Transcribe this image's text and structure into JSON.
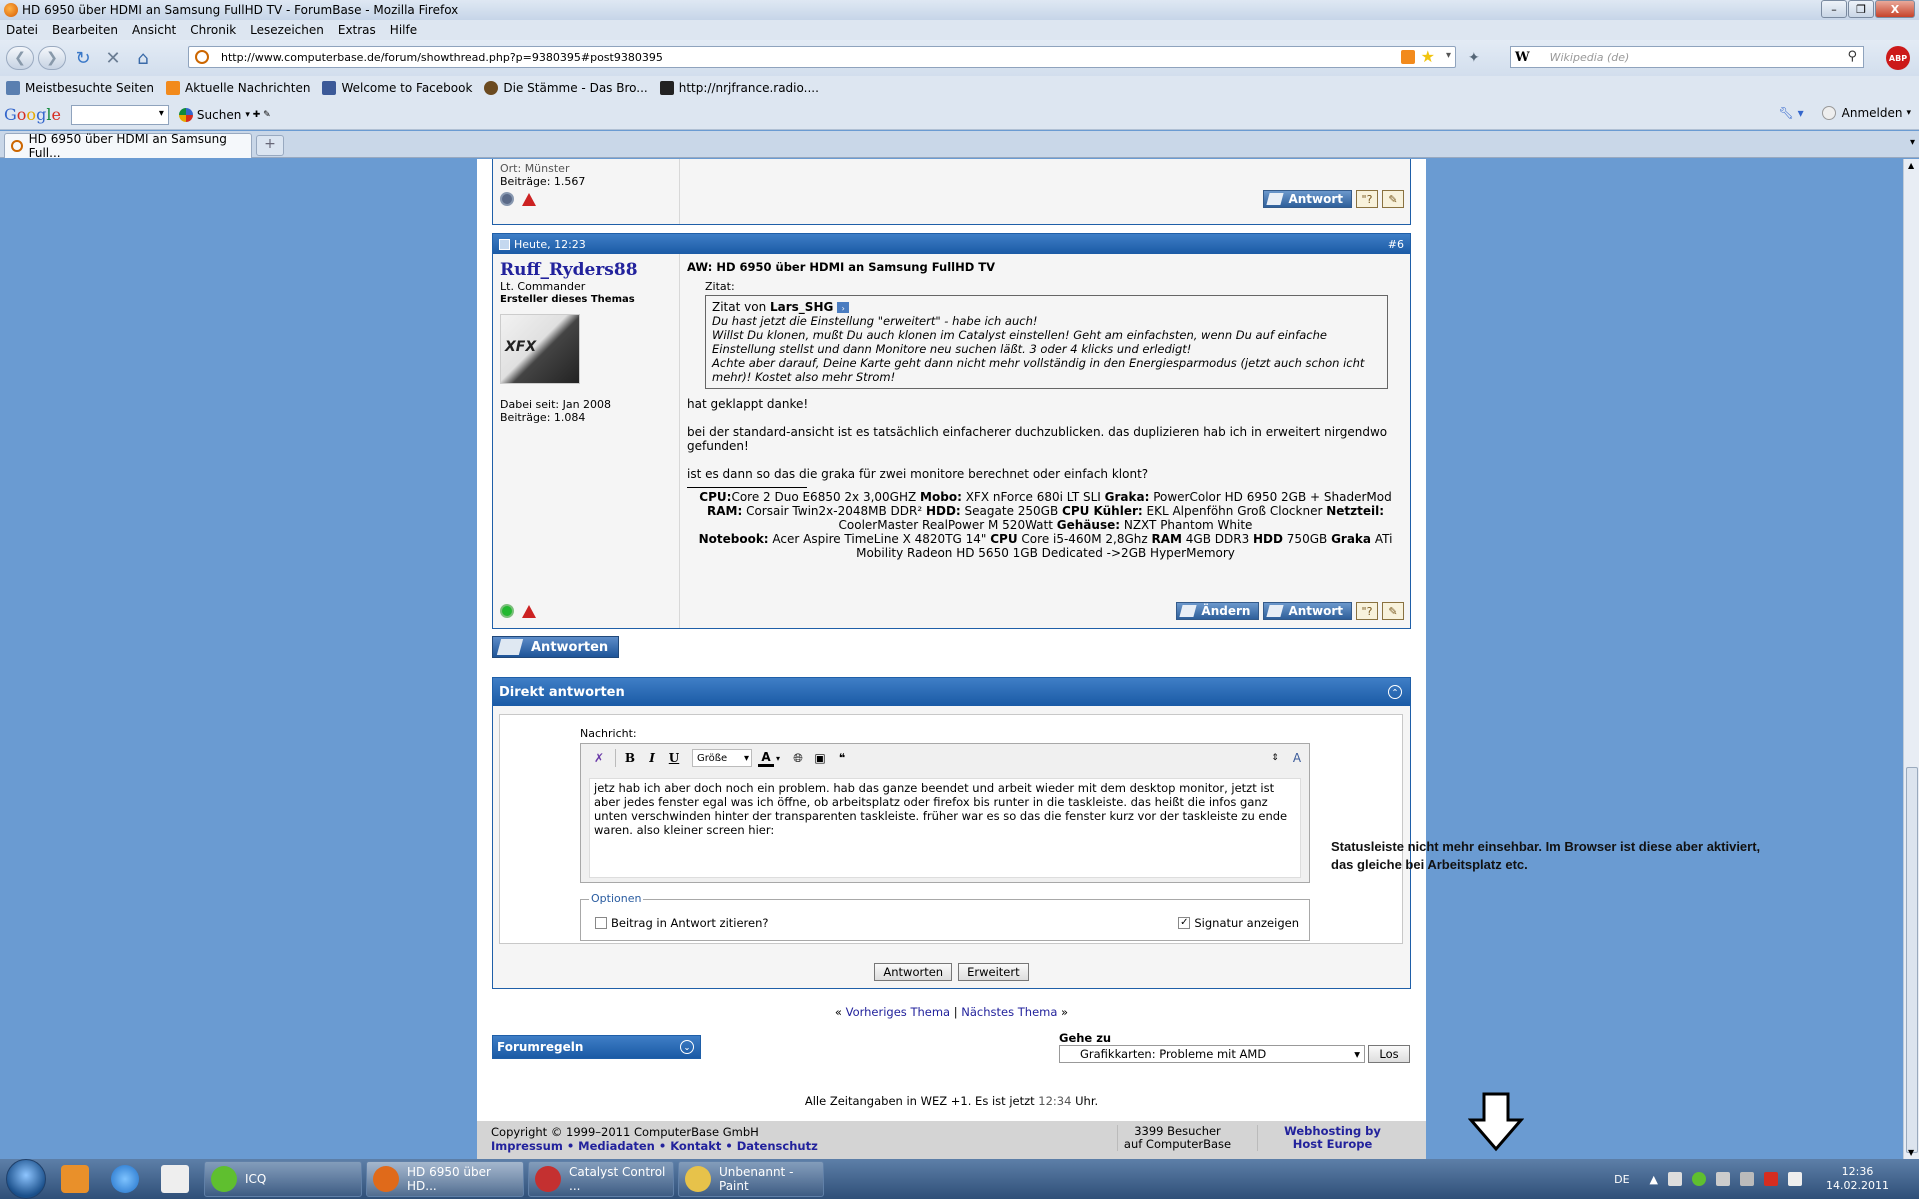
{
  "window": {
    "title": "HD 6950 über HDMI an Samsung FullHD TV - ForumBase - Mozilla Firefox",
    "controls": [
      "–",
      "❐",
      "X"
    ]
  },
  "menu": [
    "Datei",
    "Bearbeiten",
    "Ansicht",
    "Chronik",
    "Lesezeichen",
    "Extras",
    "Hilfe"
  ],
  "nav": {
    "url": "http://www.computerbase.de/forum/showthread.php?p=9380395#post9380395",
    "search_logo": "W",
    "search_placeholder": "Wikipedia (de)",
    "abp_label": "ABP"
  },
  "bookmarks": [
    {
      "label": "Meistbesuchte Seiten",
      "color": "#5a7fb0"
    },
    {
      "label": "Aktuelle Nachrichten",
      "color": "#f28a1c"
    },
    {
      "label": "Welcome to Facebook",
      "color": "#3b5998"
    },
    {
      "label": "Die Stämme - Das Bro...",
      "color": "#6b4a20"
    },
    {
      "label": "http://nrjfrance.radio....",
      "color": "#222222"
    }
  ],
  "google_bar": {
    "logo": [
      "G",
      "o",
      "o",
      "g",
      "l",
      "e"
    ],
    "suchen": "Suchen",
    "anmelden": "Anmelden"
  },
  "tab": {
    "title": "HD 6950 über HDMI an Samsung Full...",
    "new_tab": "+"
  },
  "post5": {
    "ort": "Ort: Münster",
    "beitraege": "Beiträge: 1.567",
    "btn_antwort": "Antwort"
  },
  "post6": {
    "date": "Heute, 12:23",
    "number": "#6",
    "username": "Ruff_Ryders88",
    "rank": "Lt. Commander",
    "starter": "Ersteller dieses Themas",
    "avatar_text": "XFX",
    "joined": "Dabei seit: Jan 2008",
    "posts": "Beiträge: 1.084",
    "title": "AW: HD 6950 über HDMI an Samsung FullHD TV",
    "quote_label": "Zitat:",
    "quote_by_prefix": "Zitat von ",
    "quote_author": "Lars_SHG",
    "quote_lines": [
      "Du hast jetzt die Einstellung \"erweitert\" - habe ich auch!",
      "Willst Du klonen, mußt Du auch klonen im Catalyst einstellen! Geht am einfachsten, wenn Du auf einfache Einstellung stellst und dann Monitore neu suchen läßt. 3 oder 4 klicks und erledigt!",
      "Achte aber darauf, Deine Karte geht dann nicht mehr vollständig in den Energiesparmodus (jetzt auch schon icht mehr)! Kostet also mehr Strom!"
    ],
    "paragraphs": [
      "hat geklappt danke!",
      "bei der standard-ansicht ist es tatsächlich einfacherer duchzublicken. das duplizieren hab ich in erweitert nirgendwo gefunden!",
      "ist es dann so das die graka für zwei monitore berechnet oder einfach klont?"
    ],
    "signature": {
      "cpu_l": "CPU:",
      "cpu": "Core 2 Duo E6850 2x 3,00GHZ ",
      "mobo_l": "Mobo:",
      "mobo": " XFX nForce 680i LT SLI ",
      "graka_l": "Graka:",
      "graka": " PowerColor HD 6950 2GB + ShaderMod",
      "ram_l": "RAM:",
      "ram": " Corsair Twin2x-2048MB DDR² ",
      "hdd_l": "HDD:",
      "hdd": " Seagate 250GB ",
      "kuehler_l": "CPU Kühler:",
      "kuehler": " EKL Alpenföhn Groß Clockner ",
      "netzteil_l": "Netzteil:",
      "netzteil": " CoolerMaster RealPower M 520Watt ",
      "gehaeuse_l": "Gehäuse:",
      "gehaeuse": " NZXT Phantom White",
      "nb_l": "Notebook:",
      "nb": " Acer Aspire TimeLine X 4820TG 14\" ",
      "nbcpu_l": "CPU",
      "nbcpu": " Core i5-460M 2,8Ghz ",
      "nbram_l": "RAM",
      "nbram": " 4GB DDR3 ",
      "nbhdd_l": "HDD",
      "nbhdd": " 750GB ",
      "nbgraka_l": "Graka",
      "nbgraka": " ATi Mobility Radeon HD 5650 1GB Dedicated ->2GB HyperMemory"
    },
    "btn_aendern": "Ändern",
    "btn_antwort": "Antwort"
  },
  "antworten_button": "Antworten",
  "quick_reply": {
    "title": "Direkt antworten",
    "nachricht_label": "Nachricht:",
    "size_select": "Größe",
    "toolbar": {
      "bold": "B",
      "italic": "I",
      "underline": "U",
      "font_color": "A"
    },
    "text": "jetz hab ich aber doch noch ein problem. hab das ganze beendet und arbeit wieder mit dem desktop monitor, jetzt ist aber jedes fenster egal was ich öffne, ob arbeitsplatz oder firefox bis runter in die taskleiste. das heißt die infos ganz unten verschwinden hinter der transparenten taskleiste. früher war es so das die fenster kurz vor der taskleiste zu ende waren. also kleiner screen hier:",
    "options_legend": "Optionen",
    "opt_quote": "Beitrag in Antwort zitieren?",
    "opt_signature": "Signatur anzeigen",
    "btn_submit": "Antworten",
    "btn_advanced": "Erweitert"
  },
  "thread_nav": {
    "prev": "Vorheriges Thema",
    "next": "Nächstes Thema",
    "left_q": "« ",
    "right_q": " »",
    "sep": " | "
  },
  "forumregeln": "Forumregeln",
  "gehe_zu": {
    "label": "Gehe zu",
    "value": "Grafikkarten: Probleme mit AMD",
    "btn": "Los"
  },
  "zeit": {
    "prefix": "Alle Zeitangaben in WEZ +1. Es ist jetzt ",
    "time": "12:34",
    "suffix": " Uhr."
  },
  "footer": {
    "copyright": "Copyright © 1999–2011 ComputerBase GmbH",
    "links": "Impressum • Mediadaten • Kontakt • Datenschutz",
    "besucher_1": "3399 Besucher",
    "besucher_2": "auf ComputerBase",
    "host_1": "Webhosting by",
    "host_2": "Host Europe"
  },
  "annotation": {
    "line1": "Statusleiste nicht mehr einsehbar. Im Browser ist diese aber aktiviert,",
    "line2": "das gleiche bei Arbeitsplatz etc."
  },
  "taskbar": {
    "tasks": [
      {
        "label": "ICQ",
        "color": "#5fbf2f"
      },
      {
        "label": "HD 6950 über HD...",
        "color": "#e06a1a"
      },
      {
        "label": "Catalyst Control ...",
        "color": "#c43030"
      },
      {
        "label": "Unbenannt - Paint",
        "color": "#e7c24a"
      }
    ],
    "lang": "DE",
    "time": "12:36",
    "date": "14.02.2011"
  }
}
